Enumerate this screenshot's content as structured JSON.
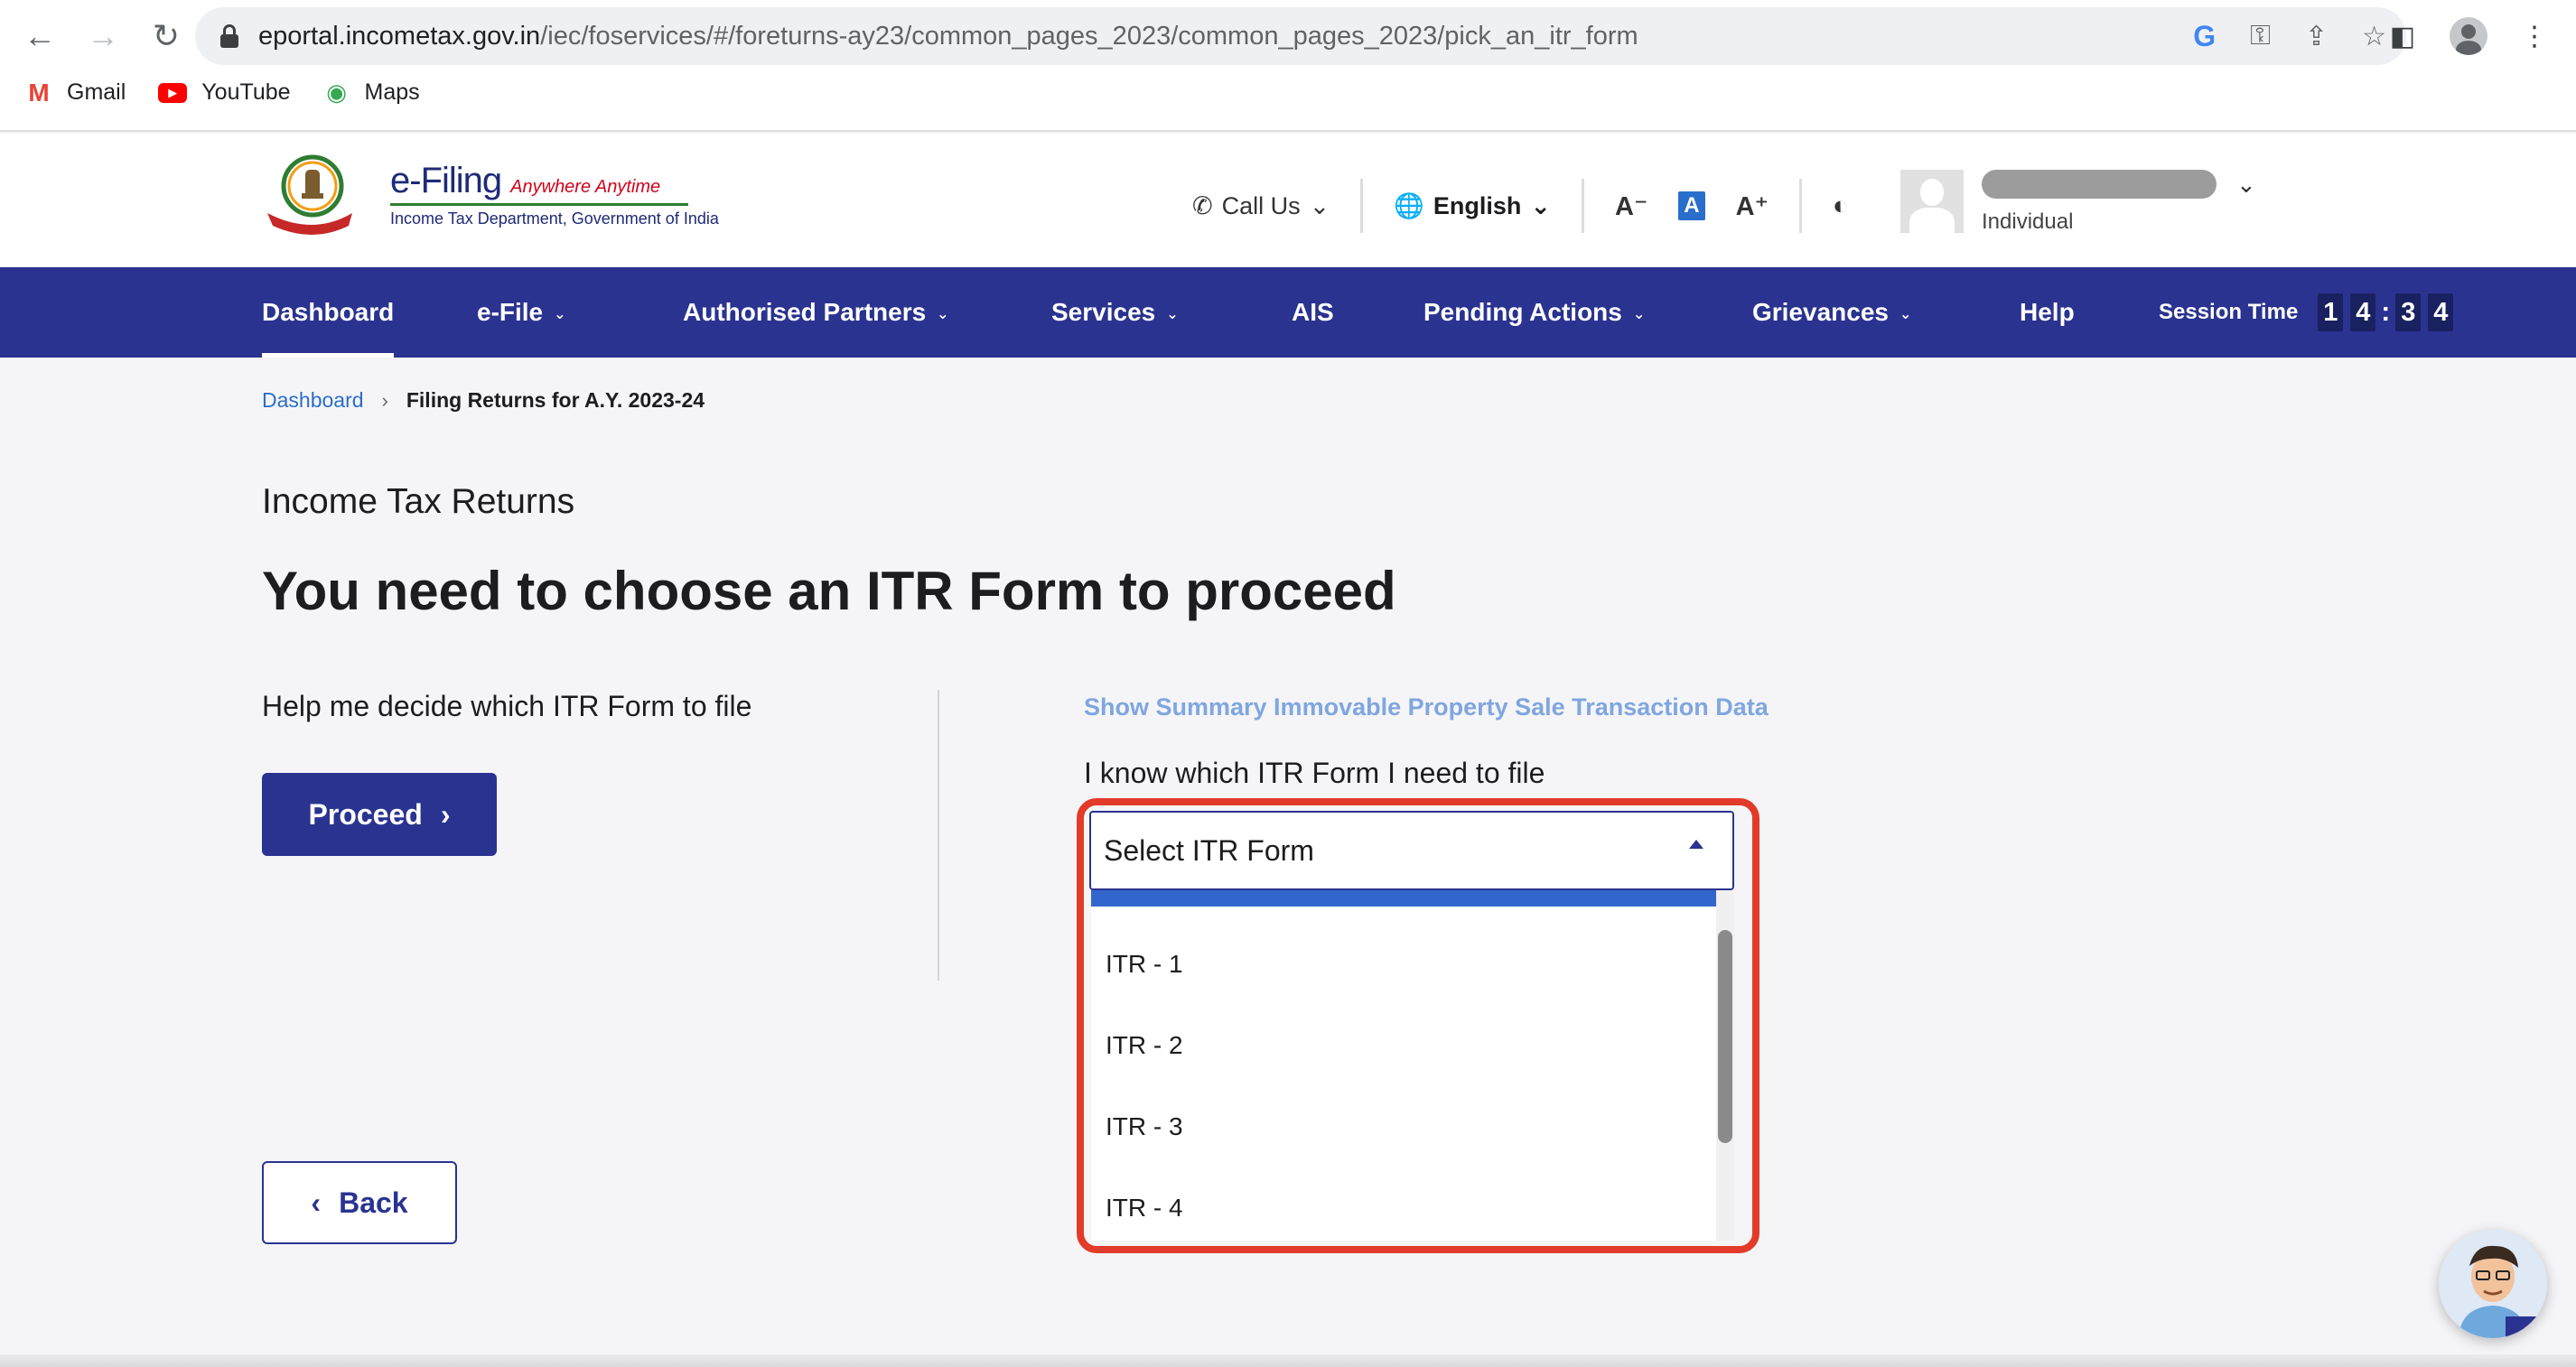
{
  "browser": {
    "url_host": "eportal.incometax.gov.in",
    "url_path": "/iec/foservices/#/foreturns-ay23/common_pages_2023/common_pages_2023/pick_an_itr_form",
    "bookmarks": [
      {
        "label": "Gmail",
        "icon": "gmail-icon"
      },
      {
        "label": "YouTube",
        "icon": "youtube-icon"
      },
      {
        "label": "Maps",
        "icon": "maps-icon"
      }
    ]
  },
  "header": {
    "logo_main": "e-Filing",
    "logo_tag": "Anywhere Anytime",
    "logo_dept": "Income Tax Department, Government of India",
    "call_us": "Call Us",
    "language": "English",
    "font_small": "A⁻",
    "font_normal": "A",
    "font_large": "A⁺",
    "user_type": "Individual"
  },
  "nav": {
    "items": [
      "Dashboard",
      "e-File",
      "Authorised Partners",
      "Services",
      "AIS",
      "Pending Actions",
      "Grievances",
      "Help"
    ],
    "session_label": "Session Time",
    "session_digits": [
      "1",
      "4",
      "3",
      "4"
    ]
  },
  "breadcrumb": {
    "home": "Dashboard",
    "current": "Filing Returns for A.Y. 2023-24"
  },
  "page": {
    "subtitle": "Income Tax Returns",
    "title": "You need to choose an ITR Form to proceed",
    "help_text": "Help me decide which ITR Form to file",
    "proceed_label": "Proceed",
    "summary_link": "Show Summary Immovable Property Sale Transaction Data",
    "know_text": "I know which ITR Form I need to file",
    "select_value": "Select ITR Form",
    "options": [
      "ITR - 1",
      "ITR - 2",
      "ITR - 3",
      "ITR - 4"
    ],
    "back_label": "Back"
  },
  "colors": {
    "nav_bg": "#2a3390",
    "highlight": "#e33b2a",
    "link": "#2a6ecb"
  }
}
